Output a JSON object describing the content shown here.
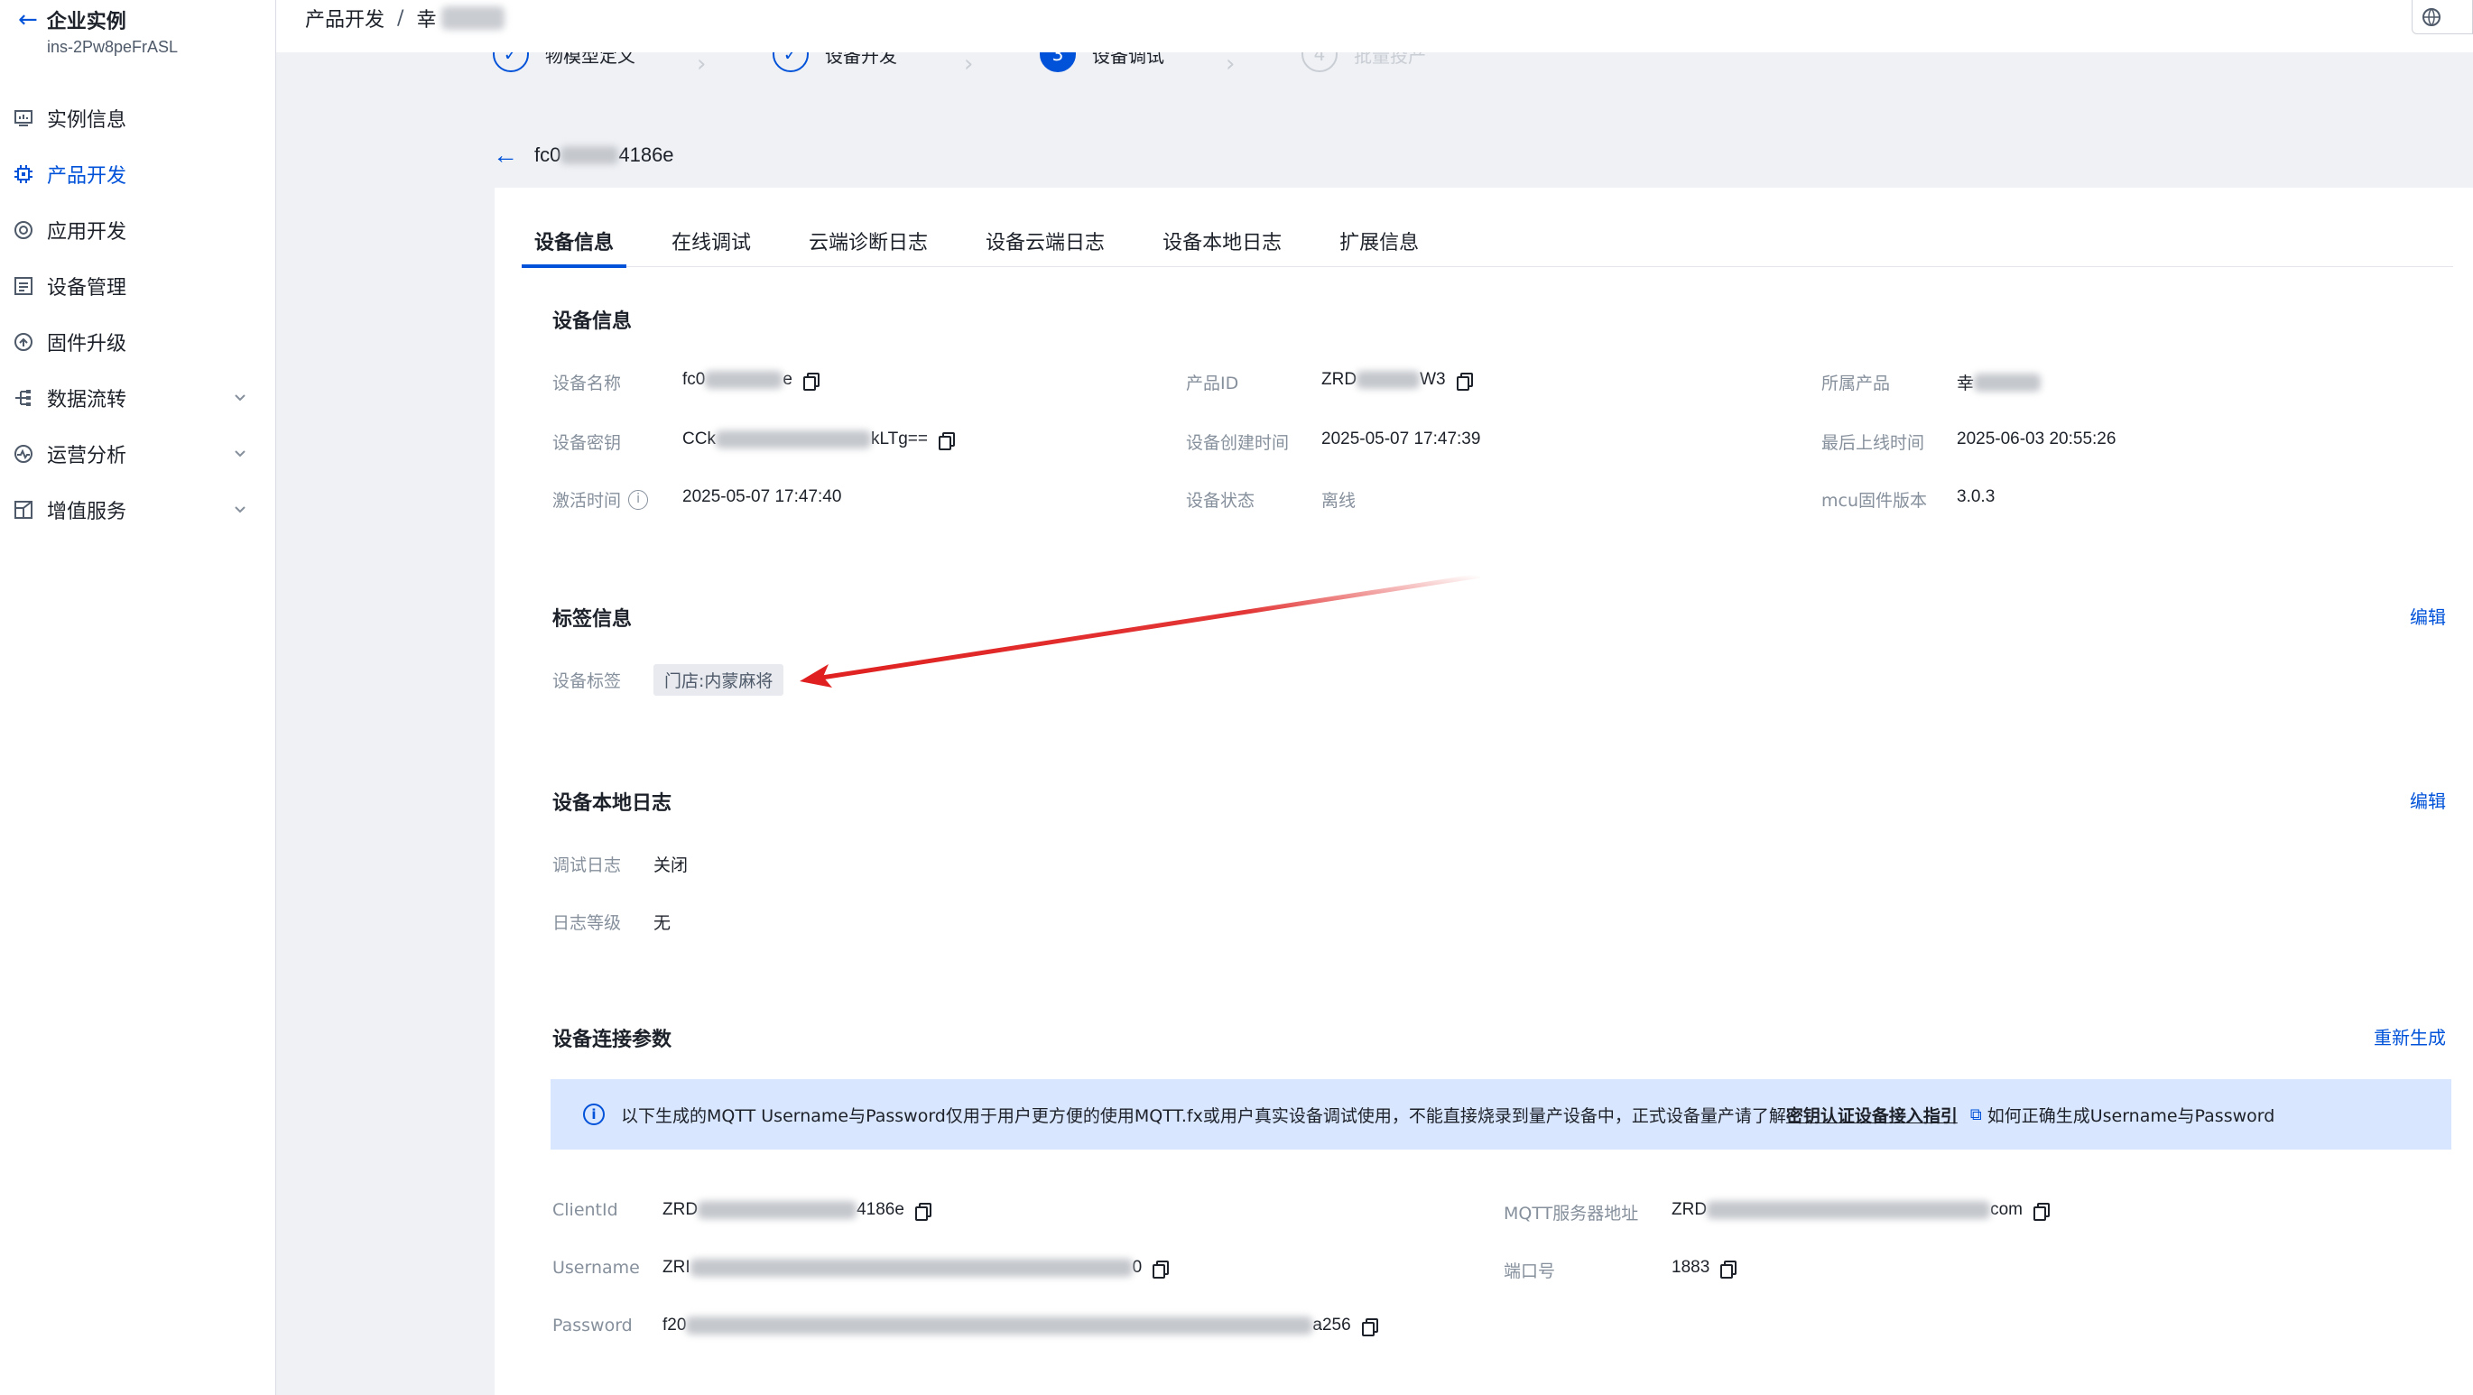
{
  "sidebar": {
    "back_title": "企业实例",
    "instance_id": "ins-2Pw8peFrASL",
    "items": [
      {
        "label": "实例信息",
        "icon": "monitor-icon",
        "active": false,
        "expandable": false
      },
      {
        "label": "产品开发",
        "icon": "gear-icon",
        "active": true,
        "expandable": false
      },
      {
        "label": "应用开发",
        "icon": "target-icon",
        "active": false,
        "expandable": false
      },
      {
        "label": "设备管理",
        "icon": "list-icon",
        "active": false,
        "expandable": false
      },
      {
        "label": "固件升级",
        "icon": "upgrade-icon",
        "active": false,
        "expandable": false
      },
      {
        "label": "数据流转",
        "icon": "flow-icon",
        "active": false,
        "expandable": true
      },
      {
        "label": "运营分析",
        "icon": "pulse-icon",
        "active": false,
        "expandable": true
      },
      {
        "label": "增值服务",
        "icon": "service-icon",
        "active": false,
        "expandable": true
      }
    ]
  },
  "breadcrumb": {
    "root": "产品开发",
    "separator": "/",
    "current": "幸"
  },
  "steps": [
    {
      "num": "✓",
      "label": "物模型定义",
      "state": "done"
    },
    {
      "num": "✓",
      "label": "设备开发",
      "state": "done"
    },
    {
      "num": "3",
      "label": "设备调试",
      "state": "current"
    },
    {
      "num": "4",
      "label": "批量投产",
      "state": "todo"
    }
  ],
  "device": {
    "title_prefix": "fc0",
    "title_suffix": "4186e"
  },
  "tabs": [
    "设备信息",
    "在线调试",
    "云端诊断日志",
    "设备云端日志",
    "设备本地日志",
    "扩展信息"
  ],
  "device_info": {
    "title": "设备信息",
    "name_label": "设备名称",
    "name_prefix": "fc0",
    "name_suffix": "e",
    "product_id_label": "产品ID",
    "product_id_prefix": "ZRD",
    "product_id_suffix": "W3",
    "product_label": "所属产品",
    "product_value": "幸",
    "secret_label": "设备密钥",
    "secret_prefix": "CCk",
    "secret_suffix": "kLTg==",
    "created_label": "设备创建时间",
    "created_value": "2025-05-07 17:47:39",
    "last_online_label": "最后上线时间",
    "last_online_value": "2025-06-03 20:55:26",
    "activated_label": "激活时间",
    "activated_value": "2025-05-07 17:47:40",
    "status_label": "设备状态",
    "status_value": "离线",
    "mcu_label": "mcu固件版本",
    "mcu_value": "3.0.3"
  },
  "tag_info": {
    "title": "标签信息",
    "edit": "编辑",
    "tag_label": "设备标签",
    "tag_value": "门店:内蒙麻将"
  },
  "local_log": {
    "title": "设备本地日志",
    "edit": "编辑",
    "debug_label": "调试日志",
    "debug_value": "关闭",
    "level_label": "日志等级",
    "level_value": "无"
  },
  "connect": {
    "title": "设备连接参数",
    "regen": "重新生成",
    "notice_text": "以下生成的MQTT Username与Password仅用于用户更方便的使用MQTT.fx或用户真实设备调试使用，不能直接烧录到量产设备中，正式设备量产请了解",
    "notice_link1": "密钥认证设备接入指引",
    "notice_link2": "如何正确生成Username与Password",
    "client_label": "ClientId",
    "client_prefix": "ZRD",
    "client_suffix": "4186e",
    "server_label": "MQTT服务器地址",
    "server_prefix": "ZRD",
    "server_suffix": "com",
    "user_label": "Username",
    "user_prefix": "ZRI",
    "user_suffix": "0",
    "port_label": "端口号",
    "port_value": "1883",
    "pass_label": "Password",
    "pass_prefix": "f20",
    "pass_suffix": "a256"
  },
  "colors": {
    "accent": "#0052d9",
    "annotation_arrow": "#e02020",
    "notice_bg": "#d9e6ff"
  }
}
